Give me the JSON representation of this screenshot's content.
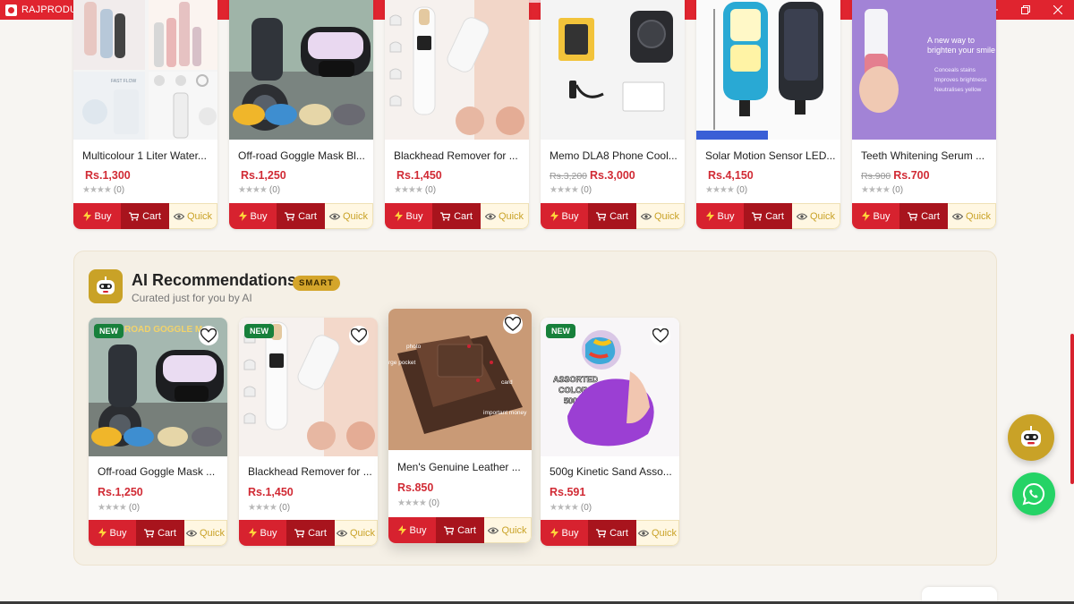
{
  "app": {
    "title": "RAJPRODUCTS"
  },
  "top_products": [
    {
      "title": "Multicolour 1 Liter Water...",
      "price": "Rs.1,300",
      "old_price": "",
      "rating_count": "(0)"
    },
    {
      "title": "Off-road Goggle Mask Bl...",
      "price": "Rs.1,250",
      "old_price": "",
      "rating_count": "(0)"
    },
    {
      "title": "Blackhead Remover for ...",
      "price": "Rs.1,450",
      "old_price": "",
      "rating_count": "(0)"
    },
    {
      "title": "Memo DLA8 Phone Cool...",
      "price": "Rs.3,000",
      "old_price": "Rs.3,200",
      "rating_count": "(0)"
    },
    {
      "title": "Solar Motion Sensor LED...",
      "price": "Rs.4,150",
      "old_price": "",
      "rating_count": "(0)"
    },
    {
      "title": "Teeth Whitening Serum ...",
      "price": "Rs.700",
      "old_price": "Rs.900",
      "rating_count": "(0)"
    }
  ],
  "actions": {
    "buy": "Buy",
    "cart": "Cart",
    "quick": "Quick"
  },
  "ai_section": {
    "title": "AI Recommendations",
    "badge": "SMART",
    "subtitle": "Curated just for you by AI",
    "products": [
      {
        "title": "Off-road Goggle Mask ...",
        "price": "Rs.1,250",
        "rating_count": "(0)",
        "badge": "NEW"
      },
      {
        "title": "Blackhead Remover for ...",
        "price": "Rs.1,450",
        "rating_count": "(0)",
        "badge": "NEW"
      },
      {
        "title": "Men's Genuine Leather ...",
        "price": "Rs.850",
        "rating_count": "(0)",
        "badge": ""
      },
      {
        "title": "500g Kinetic Sand Asso...",
        "price": "Rs.591",
        "rating_count": "(0)",
        "badge": "NEW"
      }
    ]
  },
  "image_text": {
    "serum_line1": "A new way to",
    "serum_line2": "brighten your smile",
    "serum_b1": "Conceals stains",
    "serum_b2": "Improves brightness",
    "serum_b3": "Neutralises yellow",
    "sand_line1": "ASSORTED",
    "sand_line2": "COLORS",
    "sand_line3": "500G",
    "bottle_text": "FAST FLOW",
    "wallet_label1": "photo",
    "wallet_label2": "card",
    "wallet_label3": "important money",
    "wallet_label4": "rge pocket",
    "goggle_text": "ROAD GOGGLE M"
  },
  "rating_stars": "★★★★",
  "colors": {
    "brand_red": "#e0242f",
    "cart_red": "#a8141d",
    "gold": "#c9a227",
    "whatsapp": "#25d366"
  }
}
